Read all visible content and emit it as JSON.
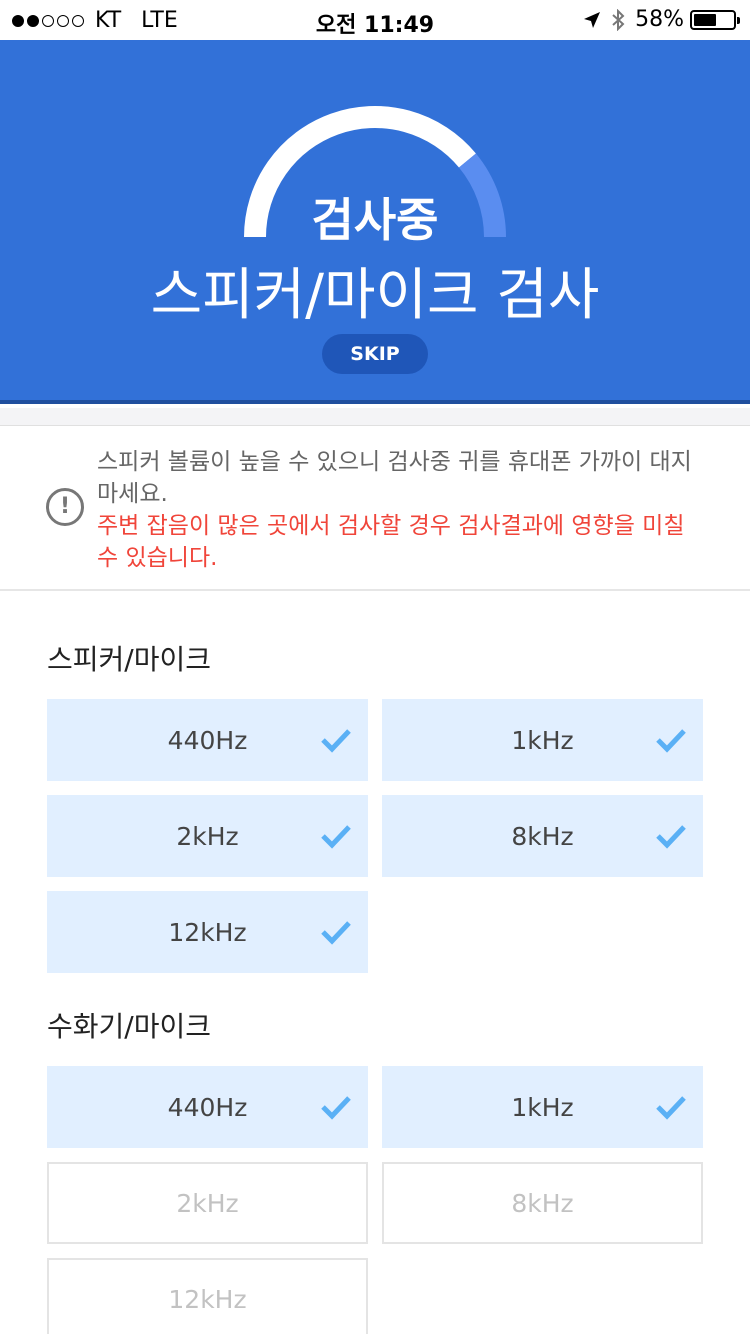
{
  "status_bar": {
    "carrier": "KT",
    "network": "LTE",
    "time": "오전 11:49",
    "battery": "58%",
    "battery_level": 0.58,
    "signal_strength": 2
  },
  "header": {
    "status": "검사중",
    "title": "스피커/마이크 검사",
    "skip_label": "SKIP",
    "progress": 0.78,
    "colors": {
      "background": "#3271d8",
      "arc_track": "#ffffff",
      "arc_accent": "#5a8df0"
    }
  },
  "notice": {
    "line_gray": "스피커 볼륨이 높을 수 있으니 검사중 귀를 휴대폰 가까이 대지 마세요.",
    "line_red": "주변 잡음이 많은 곳에서 검사할 경우 검사결과에 영향을 미칠 수 있습니다.",
    "icon": "exclamation-circle-icon"
  },
  "sections": [
    {
      "title": "스피커/마이크",
      "items": [
        {
          "label": "440Hz",
          "done": true
        },
        {
          "label": "1kHz",
          "done": true
        },
        {
          "label": "2kHz",
          "done": true
        },
        {
          "label": "8kHz",
          "done": true
        },
        {
          "label": "12kHz",
          "done": true
        }
      ]
    },
    {
      "title": "수화기/마이크",
      "items": [
        {
          "label": "440Hz",
          "done": true
        },
        {
          "label": "1kHz",
          "done": true
        },
        {
          "label": "2kHz",
          "done": false
        },
        {
          "label": "8kHz",
          "done": false
        },
        {
          "label": "12kHz",
          "done": false
        }
      ]
    }
  ],
  "colors": {
    "check": "#5ab0f5",
    "done_bg": "#e1efff",
    "warning": "#f0453a"
  }
}
